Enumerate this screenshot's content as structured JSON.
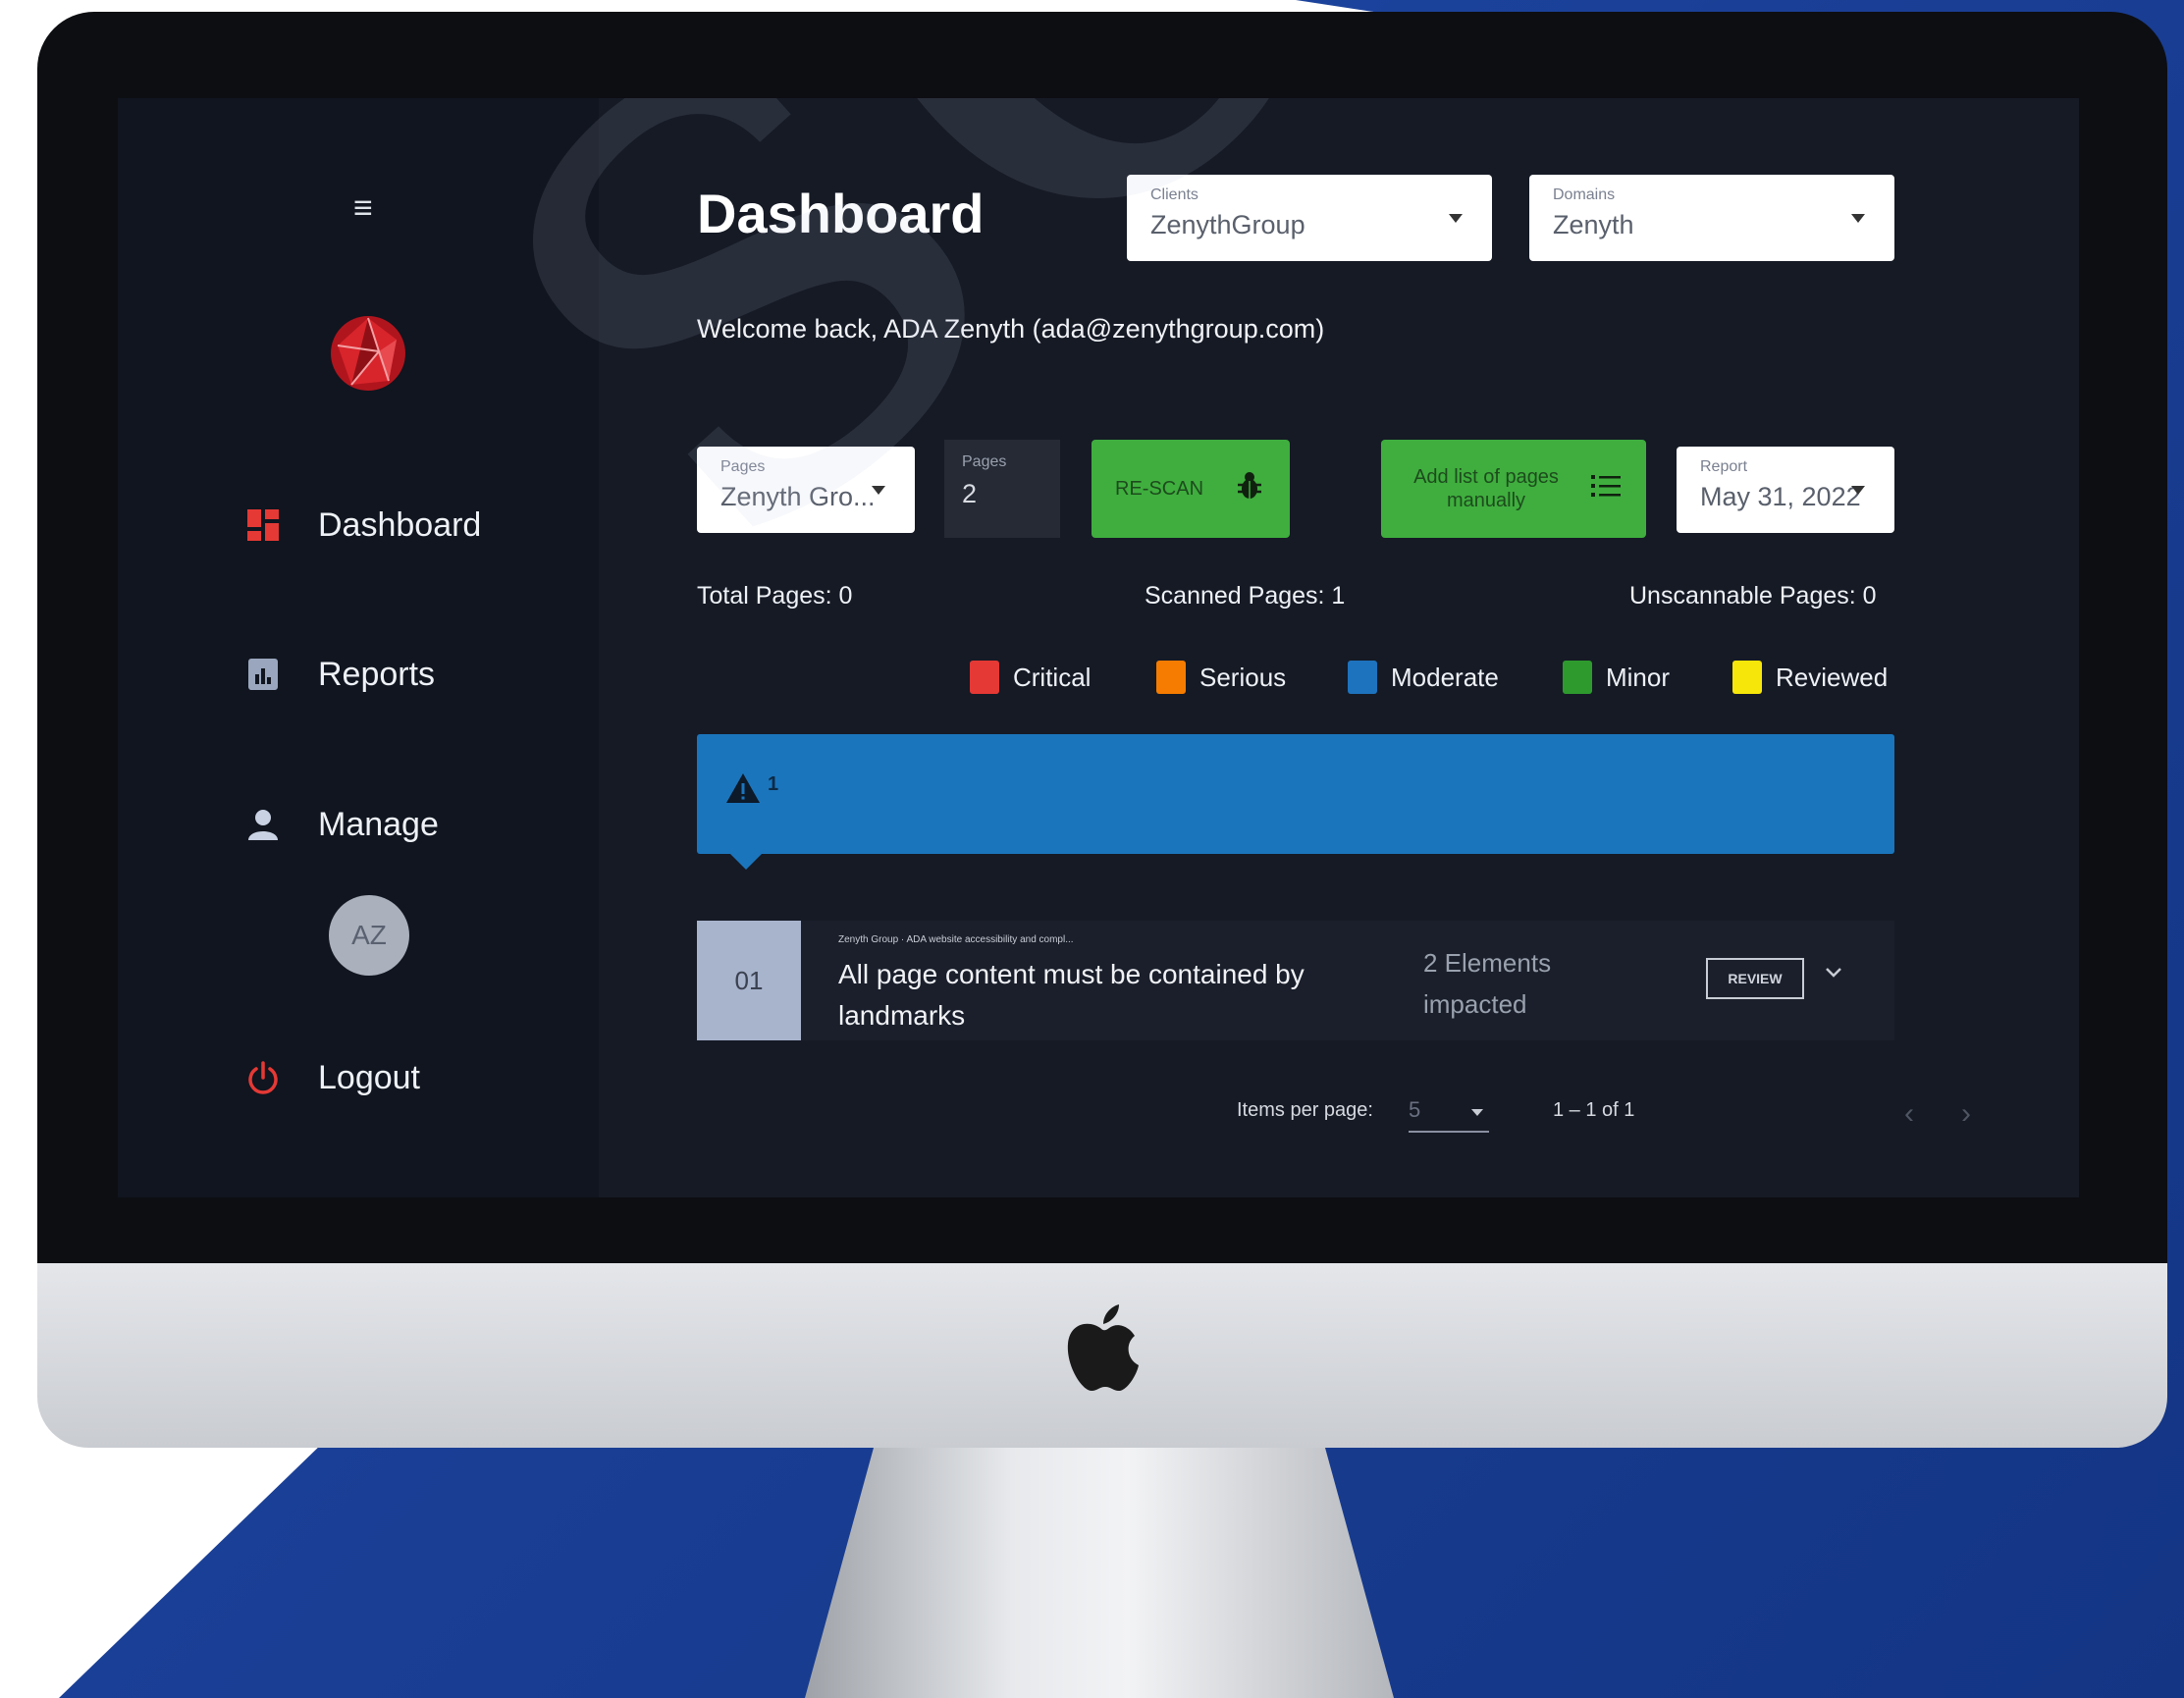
{
  "colors": {
    "accent_green": "#3fae3e",
    "bar_blue": "#1b75bc",
    "critical": "#e53935",
    "serious": "#f57c00",
    "moderate": "#1e73be",
    "minor": "#2e9a2e",
    "reviewed": "#f7e60a"
  },
  "sidebar": {
    "menu_icon": "hamburger-icon",
    "logo_icon": "faceted-sphere-logo",
    "items": [
      {
        "label": "Dashboard",
        "icon": "dashboard-icon"
      },
      {
        "label": "Reports",
        "icon": "report-icon"
      },
      {
        "label": "Manage",
        "icon": "user-icon"
      }
    ],
    "avatar_initials": "AZ",
    "logout": {
      "label": "Logout",
      "icon": "power-icon"
    }
  },
  "header": {
    "title": "Dashboard",
    "clients": {
      "label": "Clients",
      "value": "ZenythGroup"
    },
    "domains": {
      "label": "Domains",
      "value": "Zenyth"
    }
  },
  "welcome": "Welcome back, ADA Zenyth (ada@zenythgroup.com)",
  "toolbar": {
    "pages_select": {
      "label": "Pages",
      "value": "Zenyth Gro..."
    },
    "pages_input": {
      "label": "Pages",
      "value": "2"
    },
    "rescan_label": "RE-SCAN",
    "add_list_label": "Add list of pages manually",
    "report": {
      "label": "Report",
      "value": "May 31, 2022"
    }
  },
  "stats": {
    "total": "Total Pages: 0",
    "scanned": "Scanned Pages: 1",
    "unscannable": "Unscannable Pages: 0"
  },
  "legend": [
    {
      "label": "Critical",
      "color": "#e53935"
    },
    {
      "label": "Serious",
      "color": "#f57c00"
    },
    {
      "label": "Moderate",
      "color": "#1e73be"
    },
    {
      "label": "Minor",
      "color": "#2e9a2e"
    },
    {
      "label": "Reviewed",
      "color": "#f7e60a"
    }
  ],
  "summary_bar": {
    "count": "1",
    "icon": "warning-icon"
  },
  "issues": [
    {
      "number": "01",
      "subtitle": "Zenyth Group · ADA website accessibility and compl...",
      "title": "All page content must be contained by landmarks",
      "impact": "2 Elements impacted",
      "review_label": "REVIEW"
    }
  ],
  "pagination": {
    "items_per_page_label": "Items per page:",
    "items_per_page_value": "5",
    "range": "1 – 1 of 1"
  },
  "watermark": "soft"
}
